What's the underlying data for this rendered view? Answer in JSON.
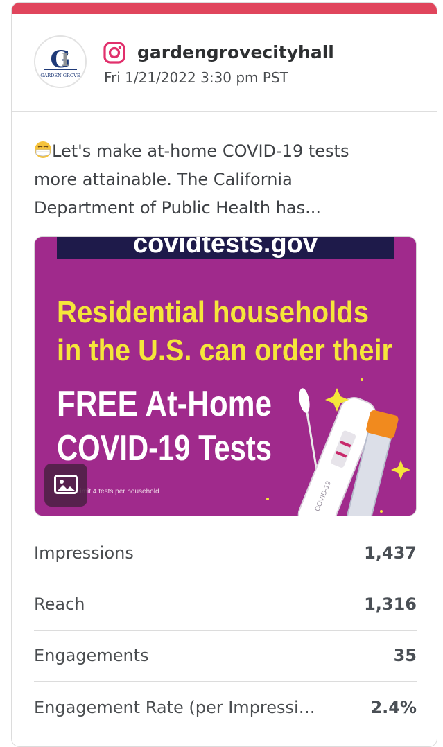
{
  "post": {
    "account": "gardengrovecityhall",
    "date": "Fri 1/21/2022 3:30 pm PST",
    "avatar_text": "GARDEN GROVE",
    "caption": "Let's make at-home COVID-19 tests more attainable. The California Department of Public Health has...",
    "image": {
      "top_text": "covidtests.gov",
      "headline_line1": "Residential households",
      "headline_line2": "in the U.S. can order their",
      "free_line1": "FREE At-Home",
      "free_line2": "COVID-19 Tests",
      "footnote": "Limit 4 tests per household",
      "kit_label": "COVID-19"
    }
  },
  "metrics": [
    {
      "label": "Impressions",
      "value": "1,437"
    },
    {
      "label": "Reach",
      "value": "1,316"
    },
    {
      "label": "Engagements",
      "value": "35"
    },
    {
      "label": "Engagement Rate (per Impressi…",
      "value": "2.4%"
    }
  ],
  "colors": {
    "accent_bar": "#e0455c",
    "instagram": "#e1306c",
    "image_bg": "#a02a8c",
    "headline_yellow": "#f5e63a"
  },
  "icons": [
    "instagram-icon",
    "image-icon",
    "mask-emoji-icon"
  ]
}
